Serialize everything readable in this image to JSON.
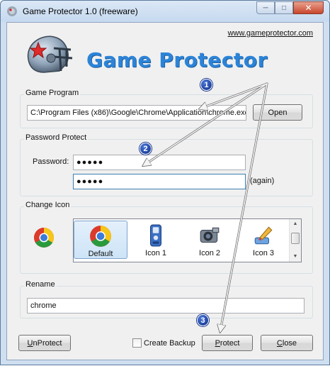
{
  "window": {
    "title": "Game Protector 1.0 (freeware)",
    "buttons": {
      "minimize": "─",
      "maximize": "□",
      "close": "✕"
    }
  },
  "header": {
    "app_name": "Game Protector",
    "url": "www.gameprotector.com"
  },
  "game_program": {
    "label": "Game Program",
    "path": "C:\\Program Files (x86)\\Google\\Chrome\\Application\\chrome.exe",
    "open_label": "Open"
  },
  "password_protect": {
    "label": "Password Protect",
    "password_label": "Password:",
    "password_value": "●●●●●",
    "confirm_value": "●●●●●",
    "again_label": "(again)"
  },
  "change_icon": {
    "label": "Change Icon",
    "items": [
      {
        "label": "Default",
        "icon": "chrome-icon",
        "selected": true
      },
      {
        "label": "Icon 1",
        "icon": "xbox-controller-icon"
      },
      {
        "label": "Icon 2",
        "icon": "camera-icon"
      },
      {
        "label": "Icon 3",
        "icon": "paint-brush-icon"
      }
    ]
  },
  "rename": {
    "label": "Rename",
    "value": "chrome"
  },
  "footer": {
    "unprotect_label": "UnProtect",
    "unprotect_accel": "U",
    "unprotect_rest": "nProtect",
    "create_backup_label": "Create Backup",
    "protect_label": "Protect",
    "protect_accel": "P",
    "protect_rest": "rotect",
    "close_label": "Close",
    "close_accel": "C",
    "close_rest": "lose"
  },
  "annotations": {
    "badge_1": "1",
    "badge_2": "2",
    "badge_3": "3"
  },
  "colors": {
    "logo_blue": "#2c84d8",
    "badge": "#0c2c86",
    "arrow": "#d8d8d8"
  }
}
